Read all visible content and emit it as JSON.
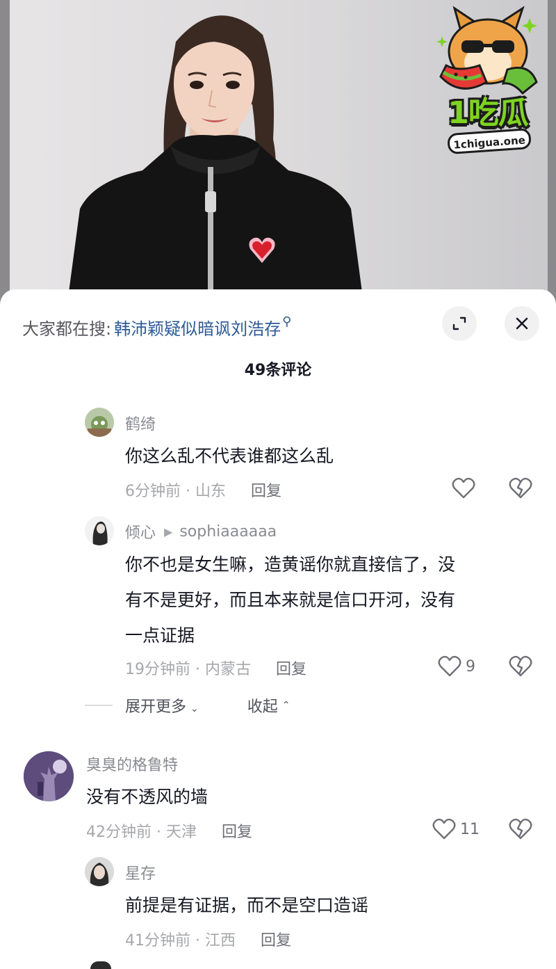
{
  "logo": {
    "text": "1吃瓜",
    "url": "1chigua.one"
  },
  "sheet": {
    "search_prefix": "大家都在搜:",
    "search_term": "韩沛颖疑似暗讽刘浩存",
    "comment_count": "49条评论"
  },
  "comments": [
    {
      "name": "鹤绮",
      "text": "你这么乱不代表谁都这么乱",
      "meta": "6分钟前 · 山东",
      "reply_label": "回复",
      "likes": ""
    },
    {
      "name": "倾心",
      "reply_to": "sophiaaaaaa",
      "text_lines": [
        "你不也是女生嘛，造黄谣你就直接信了，没",
        "有不是更好，而且本来就是信口开河，没有",
        "一点证据"
      ],
      "meta": "19分钟前 · 内蒙古",
      "reply_label": "回复",
      "likes": "9"
    },
    {
      "name": "臭臭的格鲁特",
      "text": "没有不透风的墙",
      "meta": "42分钟前 · 天津",
      "reply_label": "回复",
      "likes": "11"
    },
    {
      "name": "星存",
      "text": "前提是有证据，而不是空口造谣",
      "meta": "41分钟前 · 江西",
      "reply_label": "回复",
      "likes": ""
    }
  ],
  "thread_controls": {
    "expand_more": "展开更多",
    "collapse": "收起"
  },
  "colors": {
    "link": "#2d5a96",
    "logo_green": "#7ed321",
    "muted": "#a6a7ab"
  }
}
